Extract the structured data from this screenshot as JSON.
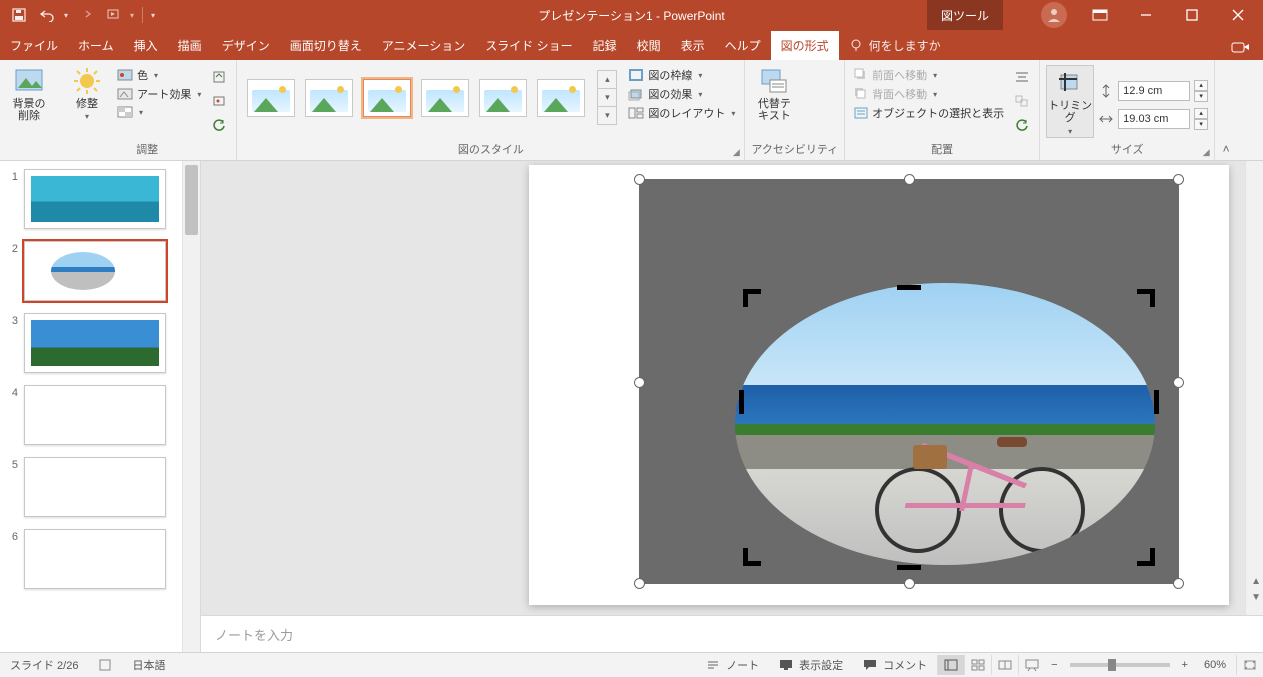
{
  "title": "プレゼンテーション1  -  PowerPoint",
  "context_tab": "図ツール",
  "tabs": {
    "file": "ファイル",
    "home": "ホーム",
    "insert": "挿入",
    "draw": "描画",
    "design": "デザイン",
    "transitions": "画面切り替え",
    "animations": "アニメーション",
    "slideshow": "スライド ショー",
    "record": "記録",
    "review": "校閲",
    "view": "表示",
    "help": "ヘルプ",
    "picformat": "図の形式"
  },
  "tellme_placeholder": "何をしますか",
  "groups": {
    "remove_bg": {
      "l1": "背景の",
      "l2": "削除"
    },
    "corrections": "修整",
    "adjust_label": "調整",
    "color": "色",
    "artistic": "アート効果",
    "styles_label": "図のスタイル",
    "border": "図の枠線",
    "effects": "図の効果",
    "layout": "図のレイアウト",
    "alt_text": {
      "l1": "代替テ",
      "l2": "キスト"
    },
    "accessibility_label": "アクセシビリティ",
    "bring_forward": "前面へ移動",
    "send_backward": "背面へ移動",
    "selection_pane": "オブジェクトの選択と表示",
    "arrange_label": "配置",
    "crop": "トリミング",
    "size_label": "サイズ",
    "height_val": "12.9 cm",
    "width_val": "19.03 cm"
  },
  "thumbs": {
    "count": 6,
    "selected": 2,
    "nums": [
      "1",
      "2",
      "3",
      "4",
      "5",
      "6"
    ]
  },
  "notes_placeholder": "ノートを入力",
  "status": {
    "slide": "スライド 2/26",
    "lang": "日本語",
    "notes_btn": "ノート",
    "display_btn": "表示設定",
    "comments_btn": "コメント",
    "zoom": "60%"
  }
}
